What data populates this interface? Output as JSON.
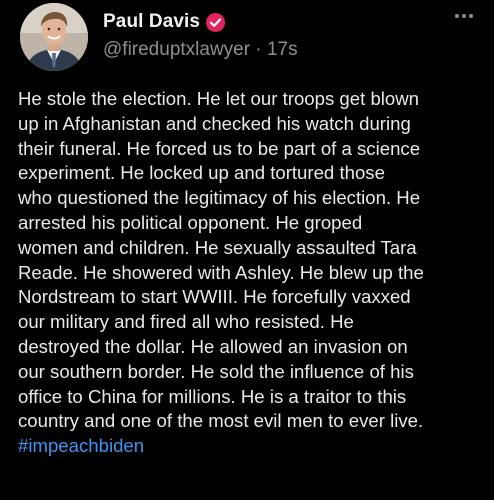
{
  "author": {
    "display_name": "Paul Davis",
    "handle": "@fireduptxlawyer",
    "separator": "·",
    "timestamp": "17s",
    "verified_badge": "check-icon"
  },
  "post": {
    "lines": [
      "He stole the election. He let our troops get blown",
      "up in Afghanistan and checked his watch during",
      "their funeral. He forced us to be part of a science",
      "experiment. He locked up and tortured those",
      "who questioned the legitimacy of his election. He",
      "arrested his political opponent. He groped",
      "women and children. He sexually assaulted Tara",
      "Reade. He showered with Ashley. He blew up the",
      "Nordstream to start WWIII. He forcefully vaxxed",
      "our military and fired all who resisted. He",
      "destroyed the dollar. He allowed an invasion on",
      "our southern border. He sold the influence of his",
      "office to China for millions. He is a traitor to this",
      "country and one of the most evil men to ever live."
    ],
    "hashtag": "#impeachbiden"
  },
  "colors": {
    "background": "#000000",
    "text": "#e7e9ea",
    "muted": "#8b8f93",
    "link": "#3b95f2",
    "badge": "#e0245e"
  }
}
